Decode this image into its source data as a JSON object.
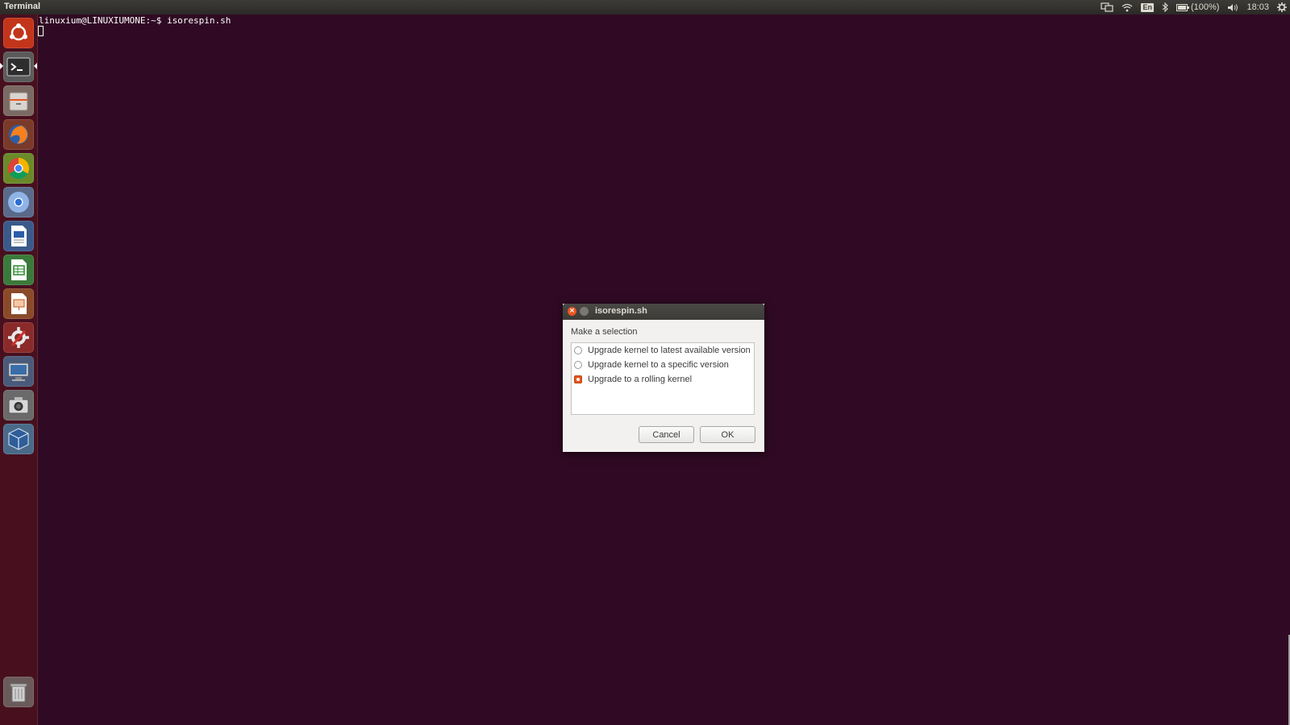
{
  "top_panel": {
    "app_title": "Terminal",
    "indicators": {
      "keyboard": "En",
      "battery": "(100%)",
      "clock": "18:03"
    }
  },
  "launcher": {
    "items": [
      {
        "name": "ubuntu-dash",
        "icon": "ubuntu-logo-icon"
      },
      {
        "name": "terminal",
        "icon": "terminal-icon",
        "active": true
      },
      {
        "name": "files",
        "icon": "file-cabinet-icon"
      },
      {
        "name": "firefox",
        "icon": "firefox-icon"
      },
      {
        "name": "chrome",
        "icon": "chrome-icon"
      },
      {
        "name": "chromium",
        "icon": "chromium-icon"
      },
      {
        "name": "libreoffice-writer",
        "icon": "writer-icon"
      },
      {
        "name": "libreoffice-calc",
        "icon": "calc-icon"
      },
      {
        "name": "libreoffice-impress",
        "icon": "impress-icon"
      },
      {
        "name": "system-settings",
        "icon": "settings-icon"
      },
      {
        "name": "remote-desktop",
        "icon": "monitor-icon"
      },
      {
        "name": "screenshot",
        "icon": "camera-icon"
      },
      {
        "name": "virtualbox",
        "icon": "virtualbox-icon"
      },
      {
        "name": "trash",
        "icon": "trash-icon"
      }
    ]
  },
  "terminal": {
    "prompt_line": "linuxium@LINUXIUMONE:~$ isorespin.sh"
  },
  "dialog": {
    "title": "isorespin.sh",
    "prompt": "Make a selection",
    "options": [
      {
        "label": "Upgrade kernel to latest available version",
        "selected": false
      },
      {
        "label": "Upgrade kernel to a specific version",
        "selected": false
      },
      {
        "label": "Upgrade to a rolling kernel",
        "selected": true
      }
    ],
    "cancel_label": "Cancel",
    "ok_label": "OK"
  },
  "colors": {
    "terminal_bg": "#300a24",
    "accent": "#e95420",
    "launcher_bg": "#48101f",
    "panel_bg": "#3c3b37"
  }
}
